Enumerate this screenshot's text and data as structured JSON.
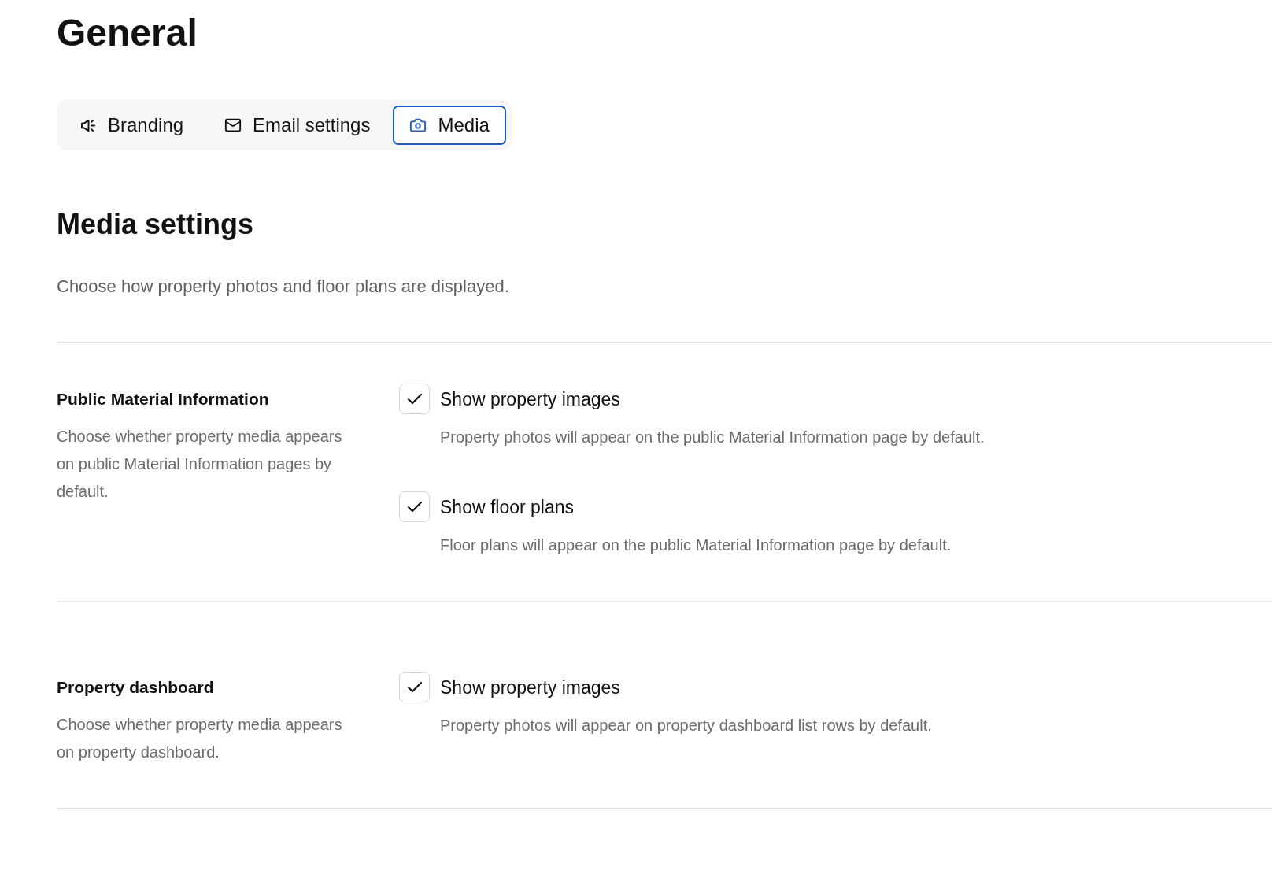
{
  "page": {
    "title": "General"
  },
  "tabs": [
    {
      "label": "Branding",
      "selected": false
    },
    {
      "label": "Email settings",
      "selected": false
    },
    {
      "label": "Media",
      "selected": true
    }
  ],
  "section": {
    "title": "Media settings",
    "description": "Choose how property photos and floor plans are displayed."
  },
  "groups": [
    {
      "title": "Public Material Information",
      "description": "Choose whether property media appears on public Material Information pages by default.",
      "options": [
        {
          "label": "Show property images",
          "help": "Property photos will appear on the public Material Information page by default.",
          "checked": true
        },
        {
          "label": "Show floor plans",
          "help": "Floor plans will appear on the public Material Information page by default.",
          "checked": true
        }
      ]
    },
    {
      "title": "Property dashboard",
      "description": "Choose whether property media appears on property dashboard.",
      "options": [
        {
          "label": "Show property images",
          "help": "Property photos will appear on property dashboard list rows by default.",
          "checked": true
        }
      ]
    }
  ]
}
